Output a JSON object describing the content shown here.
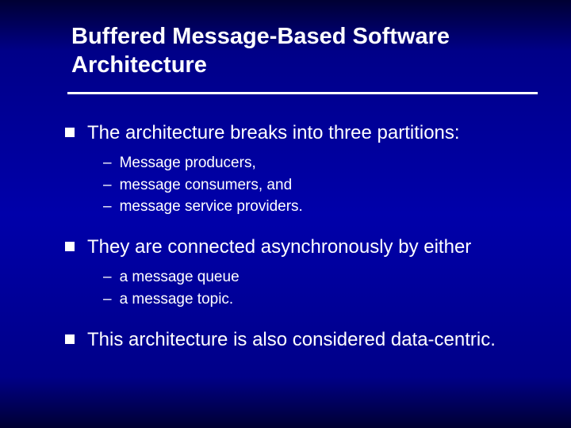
{
  "title": "Buffered Message-Based Software Architecture",
  "bullets": [
    {
      "text": "The architecture breaks into three partitions:",
      "subs": [
        "Message producers,",
        "message consumers, and",
        "message service providers."
      ]
    },
    {
      "text": "They are connected asynchronously by either",
      "subs": [
        "a message queue",
        "a message topic."
      ]
    },
    {
      "text": "This architecture is also considered data-centric.",
      "subs": []
    }
  ]
}
